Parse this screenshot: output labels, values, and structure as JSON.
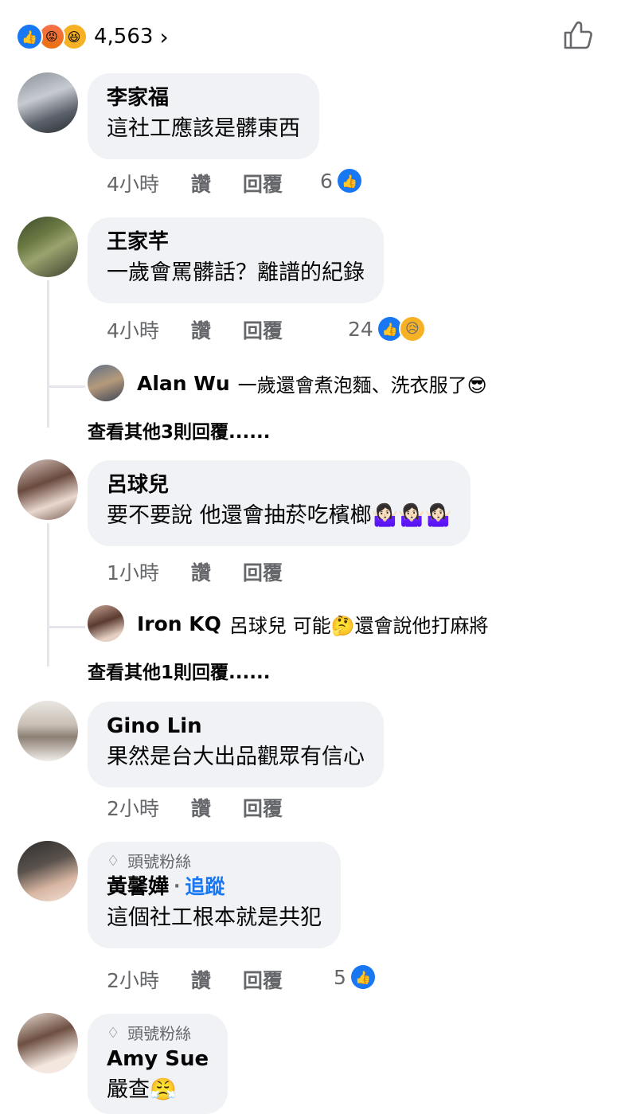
{
  "reactions": {
    "icons": [
      "like-icon",
      "angry-icon",
      "haha-icon"
    ],
    "count": "4,563",
    "chevron": "›"
  },
  "comments": [
    {
      "name": "李家福",
      "text": "這社工應該是髒東西",
      "time": "4小時",
      "like_label": "讚",
      "reply_label": "回覆",
      "likes": "6"
    },
    {
      "name": "王家芊",
      "text": "一歲會罵髒話？離譜的紀錄",
      "time": "4小時",
      "like_label": "讚",
      "reply_label": "回覆",
      "likes": "24",
      "reply": {
        "name": "Alan Wu",
        "text": "一歲還會煮泡麵、洗衣服了😎"
      },
      "more_replies": "查看其他3則回覆......"
    },
    {
      "name": "呂球兒",
      "text": "要不要說 他還會抽菸吃檳榔🤷🏻‍♀️🤷🏻‍♀️🤷🏻‍♀️",
      "time": "1小時",
      "like_label": "讚",
      "reply_label": "回覆",
      "reply": {
        "name": "Iron KQ",
        "text": "呂球兒 可能🤔還會說他打麻將"
      },
      "more_replies": "查看其他1則回覆......"
    },
    {
      "name": "Gino Lin",
      "text": "果然是台大出品觀眾有信心",
      "time": "2小時",
      "like_label": "讚",
      "reply_label": "回覆"
    },
    {
      "badge": "頭號粉絲",
      "name": "黃馨嬅",
      "follow": "追蹤",
      "text": "這個社工根本就是共犯",
      "time": "2小時",
      "like_label": "讚",
      "reply_label": "回覆",
      "likes": "5"
    },
    {
      "badge": "頭號粉絲",
      "name": "Amy Sue",
      "text": "嚴查😤"
    }
  ],
  "colors": {
    "brand_blue": "#1877f2",
    "bubble": "#f0f2f5",
    "muted": "#65676b"
  }
}
